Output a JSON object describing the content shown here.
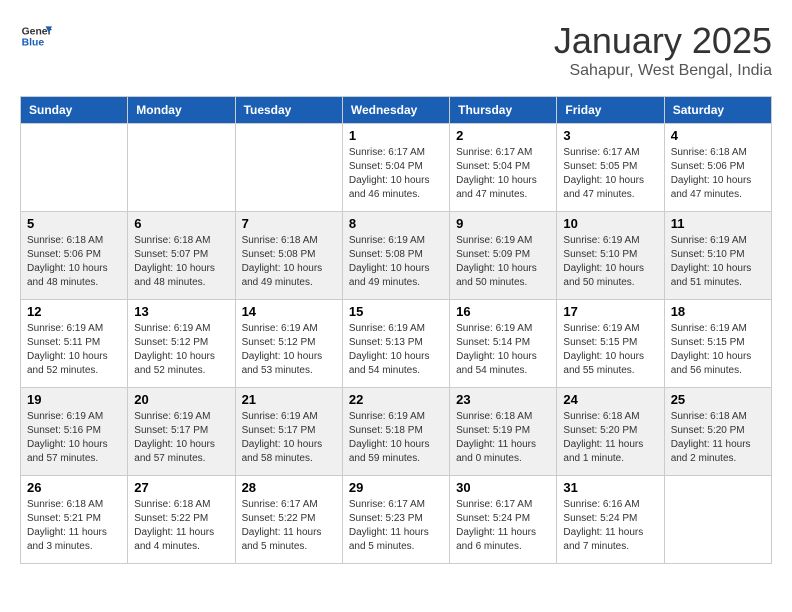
{
  "header": {
    "logo_line1": "General",
    "logo_line2": "Blue",
    "month": "January 2025",
    "location": "Sahapur, West Bengal, India"
  },
  "days_of_week": [
    "Sunday",
    "Monday",
    "Tuesday",
    "Wednesday",
    "Thursday",
    "Friday",
    "Saturday"
  ],
  "weeks": [
    [
      {
        "day": "",
        "info": ""
      },
      {
        "day": "",
        "info": ""
      },
      {
        "day": "",
        "info": ""
      },
      {
        "day": "1",
        "info": "Sunrise: 6:17 AM\nSunset: 5:04 PM\nDaylight: 10 hours\nand 46 minutes."
      },
      {
        "day": "2",
        "info": "Sunrise: 6:17 AM\nSunset: 5:04 PM\nDaylight: 10 hours\nand 47 minutes."
      },
      {
        "day": "3",
        "info": "Sunrise: 6:17 AM\nSunset: 5:05 PM\nDaylight: 10 hours\nand 47 minutes."
      },
      {
        "day": "4",
        "info": "Sunrise: 6:18 AM\nSunset: 5:06 PM\nDaylight: 10 hours\nand 47 minutes."
      }
    ],
    [
      {
        "day": "5",
        "info": "Sunrise: 6:18 AM\nSunset: 5:06 PM\nDaylight: 10 hours\nand 48 minutes."
      },
      {
        "day": "6",
        "info": "Sunrise: 6:18 AM\nSunset: 5:07 PM\nDaylight: 10 hours\nand 48 minutes."
      },
      {
        "day": "7",
        "info": "Sunrise: 6:18 AM\nSunset: 5:08 PM\nDaylight: 10 hours\nand 49 minutes."
      },
      {
        "day": "8",
        "info": "Sunrise: 6:19 AM\nSunset: 5:08 PM\nDaylight: 10 hours\nand 49 minutes."
      },
      {
        "day": "9",
        "info": "Sunrise: 6:19 AM\nSunset: 5:09 PM\nDaylight: 10 hours\nand 50 minutes."
      },
      {
        "day": "10",
        "info": "Sunrise: 6:19 AM\nSunset: 5:10 PM\nDaylight: 10 hours\nand 50 minutes."
      },
      {
        "day": "11",
        "info": "Sunrise: 6:19 AM\nSunset: 5:10 PM\nDaylight: 10 hours\nand 51 minutes."
      }
    ],
    [
      {
        "day": "12",
        "info": "Sunrise: 6:19 AM\nSunset: 5:11 PM\nDaylight: 10 hours\nand 52 minutes."
      },
      {
        "day": "13",
        "info": "Sunrise: 6:19 AM\nSunset: 5:12 PM\nDaylight: 10 hours\nand 52 minutes."
      },
      {
        "day": "14",
        "info": "Sunrise: 6:19 AM\nSunset: 5:12 PM\nDaylight: 10 hours\nand 53 minutes."
      },
      {
        "day": "15",
        "info": "Sunrise: 6:19 AM\nSunset: 5:13 PM\nDaylight: 10 hours\nand 54 minutes."
      },
      {
        "day": "16",
        "info": "Sunrise: 6:19 AM\nSunset: 5:14 PM\nDaylight: 10 hours\nand 54 minutes."
      },
      {
        "day": "17",
        "info": "Sunrise: 6:19 AM\nSunset: 5:15 PM\nDaylight: 10 hours\nand 55 minutes."
      },
      {
        "day": "18",
        "info": "Sunrise: 6:19 AM\nSunset: 5:15 PM\nDaylight: 10 hours\nand 56 minutes."
      }
    ],
    [
      {
        "day": "19",
        "info": "Sunrise: 6:19 AM\nSunset: 5:16 PM\nDaylight: 10 hours\nand 57 minutes."
      },
      {
        "day": "20",
        "info": "Sunrise: 6:19 AM\nSunset: 5:17 PM\nDaylight: 10 hours\nand 57 minutes."
      },
      {
        "day": "21",
        "info": "Sunrise: 6:19 AM\nSunset: 5:17 PM\nDaylight: 10 hours\nand 58 minutes."
      },
      {
        "day": "22",
        "info": "Sunrise: 6:19 AM\nSunset: 5:18 PM\nDaylight: 10 hours\nand 59 minutes."
      },
      {
        "day": "23",
        "info": "Sunrise: 6:18 AM\nSunset: 5:19 PM\nDaylight: 11 hours\nand 0 minutes."
      },
      {
        "day": "24",
        "info": "Sunrise: 6:18 AM\nSunset: 5:20 PM\nDaylight: 11 hours\nand 1 minute."
      },
      {
        "day": "25",
        "info": "Sunrise: 6:18 AM\nSunset: 5:20 PM\nDaylight: 11 hours\nand 2 minutes."
      }
    ],
    [
      {
        "day": "26",
        "info": "Sunrise: 6:18 AM\nSunset: 5:21 PM\nDaylight: 11 hours\nand 3 minutes."
      },
      {
        "day": "27",
        "info": "Sunrise: 6:18 AM\nSunset: 5:22 PM\nDaylight: 11 hours\nand 4 minutes."
      },
      {
        "day": "28",
        "info": "Sunrise: 6:17 AM\nSunset: 5:22 PM\nDaylight: 11 hours\nand 5 minutes."
      },
      {
        "day": "29",
        "info": "Sunrise: 6:17 AM\nSunset: 5:23 PM\nDaylight: 11 hours\nand 5 minutes."
      },
      {
        "day": "30",
        "info": "Sunrise: 6:17 AM\nSunset: 5:24 PM\nDaylight: 11 hours\nand 6 minutes."
      },
      {
        "day": "31",
        "info": "Sunrise: 6:16 AM\nSunset: 5:24 PM\nDaylight: 11 hours\nand 7 minutes."
      },
      {
        "day": "",
        "info": ""
      }
    ]
  ]
}
